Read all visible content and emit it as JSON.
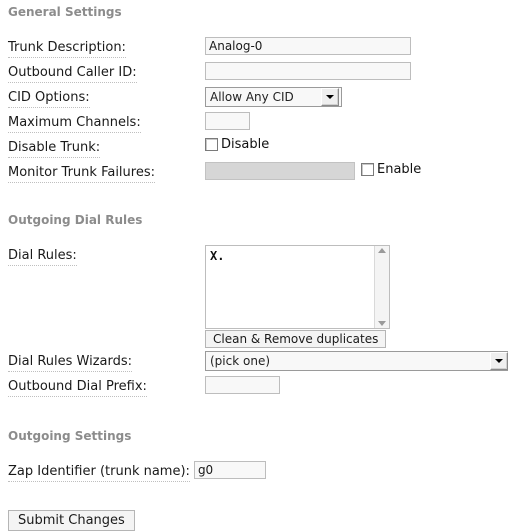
{
  "sections": {
    "general": {
      "title": "General Settings"
    },
    "dial_rules": {
      "title": "Outgoing Dial Rules"
    },
    "outgoing": {
      "title": "Outgoing Settings"
    }
  },
  "fields": {
    "trunk_description": {
      "label": "Trunk Description:",
      "value": "Analog-0",
      "placeholder": ""
    },
    "outbound_caller_id": {
      "label": "Outbound Caller ID:",
      "value": "",
      "placeholder": ""
    },
    "cid_options": {
      "label": "CID Options:",
      "selected": "Allow Any CID"
    },
    "maximum_channels": {
      "label": "Maximum Channels:",
      "value": "",
      "placeholder": ""
    },
    "disable_trunk": {
      "label": "Disable Trunk:",
      "checkbox_label": "Disable",
      "checked": false
    },
    "monitor_trunk_failures": {
      "label": "Monitor Trunk Failures:",
      "value": "",
      "checkbox_label": "Enable",
      "checked": false,
      "disabled": true
    },
    "dial_rules": {
      "label": "Dial Rules:",
      "value": "X."
    },
    "clean_button": {
      "label": "Clean & Remove duplicates"
    },
    "dial_rules_wizards": {
      "label": "Dial Rules Wizards:",
      "selected": "(pick one)"
    },
    "outbound_dial_prefix": {
      "label": "Outbound Dial Prefix:",
      "value": "",
      "placeholder": ""
    },
    "zap_identifier": {
      "label": "Zap Identifier (trunk name):",
      "value": "g0",
      "placeholder": ""
    }
  },
  "actions": {
    "submit": {
      "label": "Submit Changes"
    }
  },
  "colors": {
    "heading": "#8c8c8c",
    "text": "#1a1a1a",
    "input_bg": "#f8f8f8",
    "input_border": "#bdbdbd",
    "disabled_bg": "#d6d6d6"
  }
}
